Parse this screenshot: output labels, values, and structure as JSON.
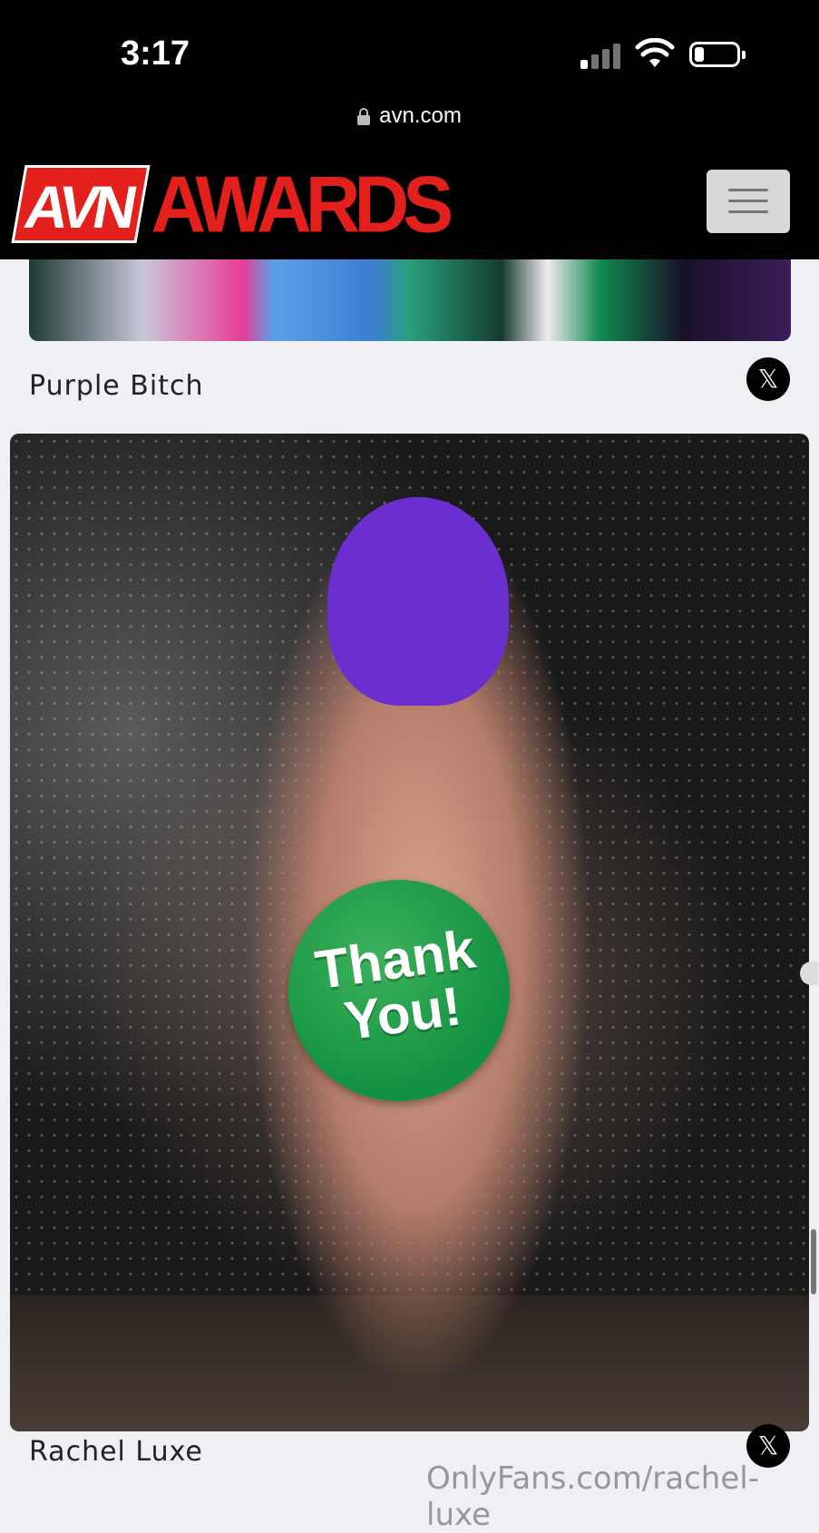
{
  "status": {
    "time": "3:17",
    "signal_icon": "cellular-signal-icon",
    "wifi_icon": "wifi-icon",
    "battery_icon": "battery-icon",
    "battery_level": 0.18
  },
  "browser": {
    "url": "avn.com",
    "lock_icon": "lock-icon"
  },
  "header": {
    "logo_avn": "AVN",
    "logo_awards": "AWARDS",
    "menu_icon": "hamburger-menu-icon",
    "brand_color": "#e3201b"
  },
  "entries": [
    {
      "name": "Purple Bitch",
      "share_icon": "x-logo-icon",
      "share_glyph": "𝕏"
    },
    {
      "name": "Rachel Luxe",
      "share_icon": "x-logo-icon",
      "share_glyph": "𝕏"
    }
  ],
  "overlay": {
    "badge_text": "Thank\nYou!",
    "badge_color": "#119141"
  },
  "watermark": "OnlyFans.com/rachel-luxe"
}
